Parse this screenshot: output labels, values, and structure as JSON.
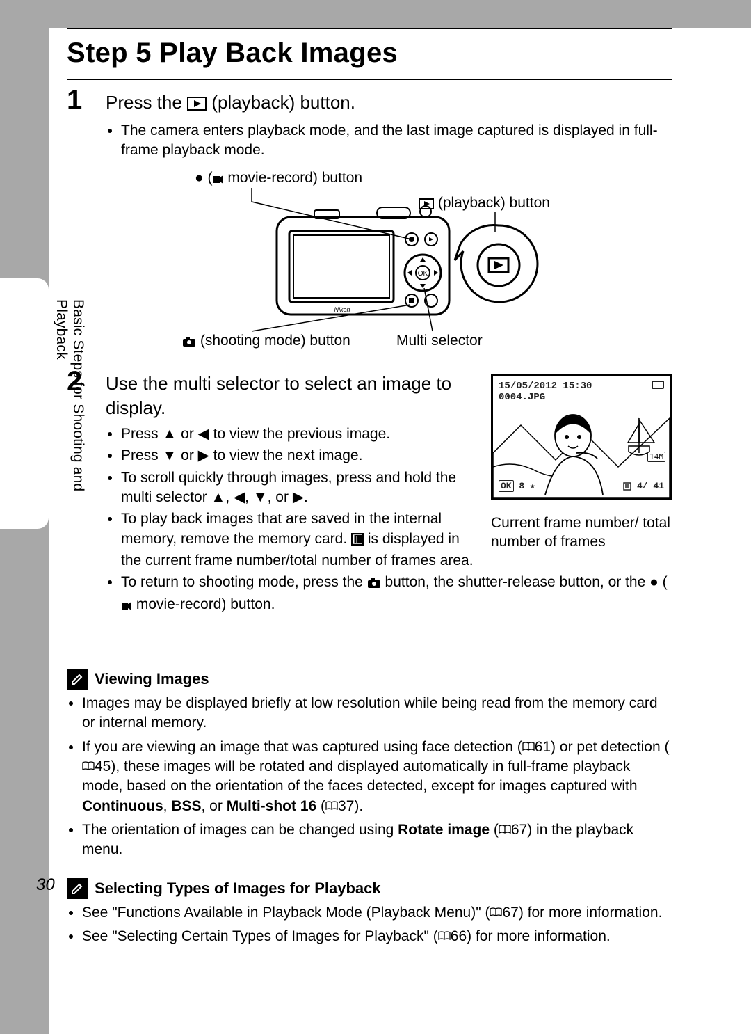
{
  "header": {
    "title": "Step 5 Play Back Images"
  },
  "side_tab": "Basic Steps for Shooting and Playback",
  "page_number": "30",
  "step1": {
    "num": "1",
    "head_before": "Press the ",
    "head_after": " (playback) button.",
    "bullet1": "The camera enters playback mode, and the last image captured is displayed in full-frame playback mode."
  },
  "diagram": {
    "label_movie_record": " movie-record) button",
    "label_playback": " (playback) button",
    "label_shoot": " (shooting mode) button",
    "label_multi": "Multi selector"
  },
  "step2": {
    "num": "2",
    "head": "Use the multi selector to select an image to display.",
    "b1a": "Press ",
    "b1b": " or ",
    "b1c": " to view the previous image.",
    "b2a": "Press ",
    "b2b": " or ",
    "b2c": " to view the next image.",
    "b3a": "To scroll quickly through images, press and hold the multi selector ",
    "b3b": ", ",
    "b3c": ", ",
    "b3d": ", or ",
    "b3e": ".",
    "b4a": "To play back images that are saved in the internal memory, remove the memory card. ",
    "b4b": " is displayed in the current frame number/total number of frames area.",
    "b5a": "To return to shooting mode, press the ",
    "b5b": " button, the shutter-release button, or the ",
    "b5c": " (",
    "b5d": " movie-record) button."
  },
  "preview": {
    "date": "15/05/2012 15:30",
    "filename": "0004.JPG",
    "size_badge": "14M",
    "ok": "OK",
    "zoom": "8",
    "star": "★",
    "frame_cur": "4",
    "frame_sep": "/",
    "frame_tot": "41",
    "caption": "Current frame number/ total number of frames"
  },
  "notes": {
    "viewing_title": "Viewing Images",
    "v1": "Images may be displayed briefly at low resolution while being read from the memory card or internal memory.",
    "v2a": "If you are viewing an image that was captured using face detection (",
    "v2b": "61) or pet detection (",
    "v2c": "45), these images will be rotated and displayed automatically in full-frame playback mode, based on the orientation of the faces detected, except for images captured with ",
    "v2d": "Continuous",
    "v2e": ", ",
    "v2f": "BSS",
    "v2g": ", or ",
    "v2h": "Multi-shot 16",
    "v2i": " (",
    "v2j": "37).",
    "v3a": "The orientation of images can be changed using ",
    "v3b": "Rotate image",
    "v3c": " (",
    "v3d": "67) in the playback menu.",
    "selecting_title": "Selecting Types of Images for Playback",
    "s1a": "See \"Functions Available in Playback Mode (Playback Menu)\" (",
    "s1b": "67) for more information.",
    "s2a": "See \"Selecting Certain Types of Images for Playback\" (",
    "s2b": "66) for more information."
  }
}
